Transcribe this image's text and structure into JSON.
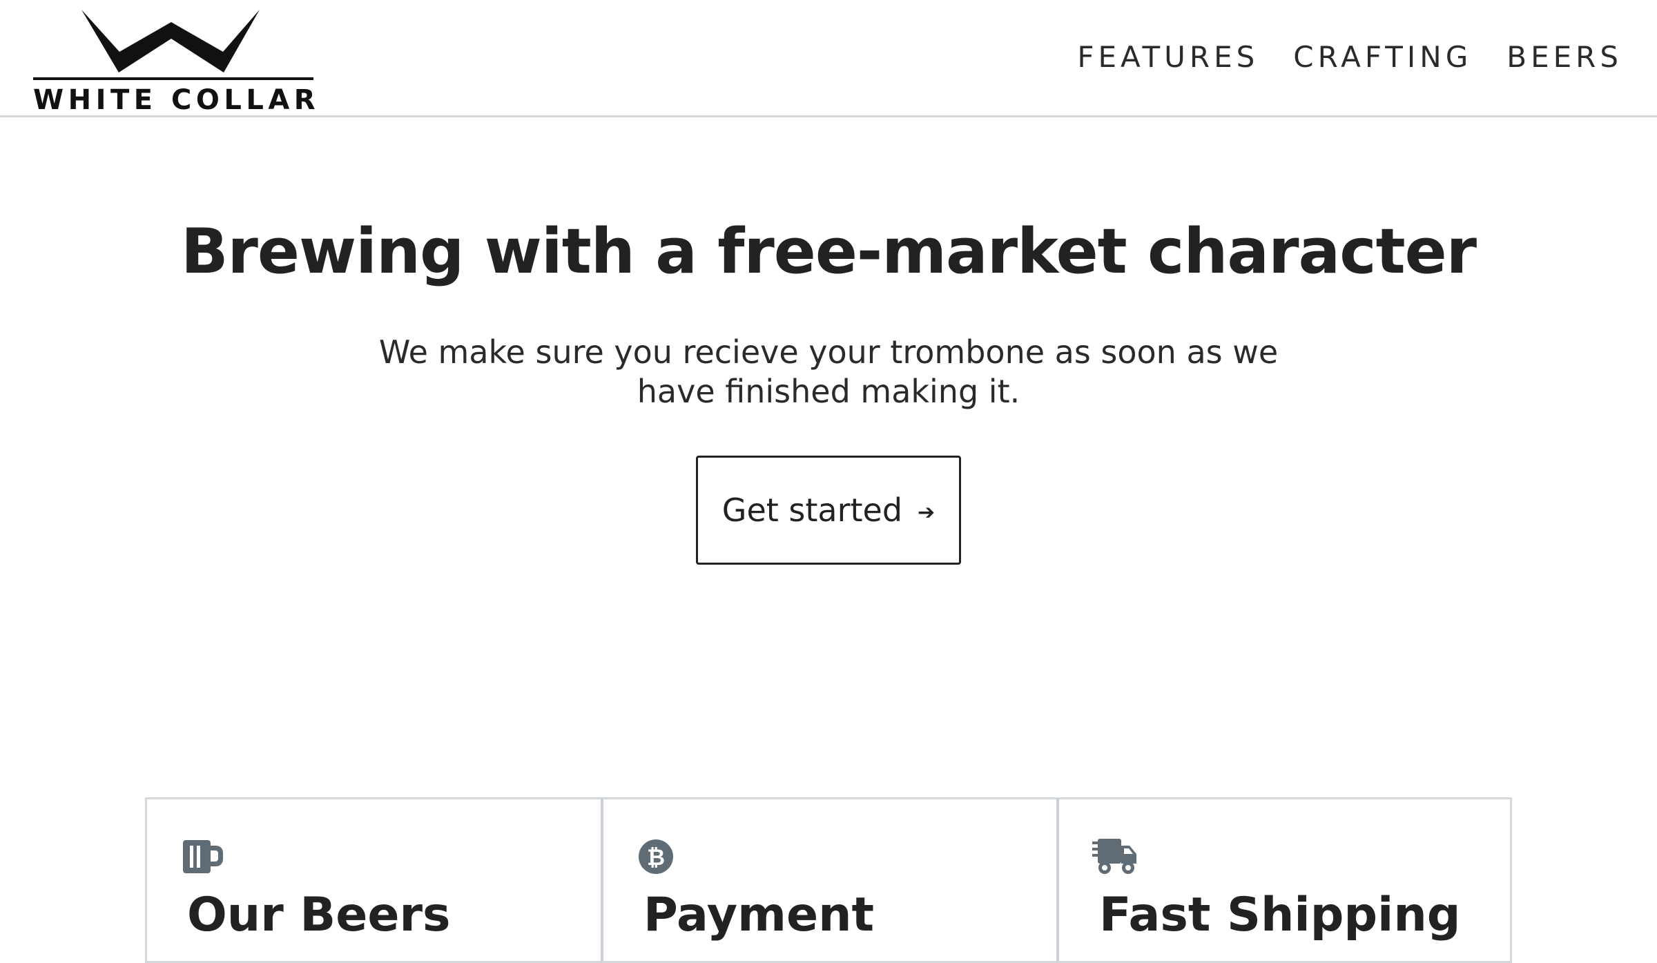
{
  "brand": {
    "name": "WHITE COLLAR",
    "logo_icon": "w-chevron-logo"
  },
  "nav": {
    "items": [
      {
        "label": "FEATURES"
      },
      {
        "label": "CRAFTING"
      },
      {
        "label": "BEERS"
      }
    ]
  },
  "hero": {
    "title": "Brewing with a free-market character",
    "subtitle": "We make sure you recieve your trombone as soon as we have finished making it.",
    "cta_label": "Get started",
    "cta_icon": "arrow-right-icon"
  },
  "features": [
    {
      "title": "Our Beers",
      "icon": "beer-mug-icon"
    },
    {
      "title": "Payment",
      "icon": "bitcoin-icon"
    },
    {
      "title": "Fast Shipping",
      "icon": "shipping-truck-icon"
    }
  ],
  "colors": {
    "text": "#222222",
    "icon": "#5f6b75",
    "divider": "#d3d8dd",
    "background": "#ffffff"
  }
}
